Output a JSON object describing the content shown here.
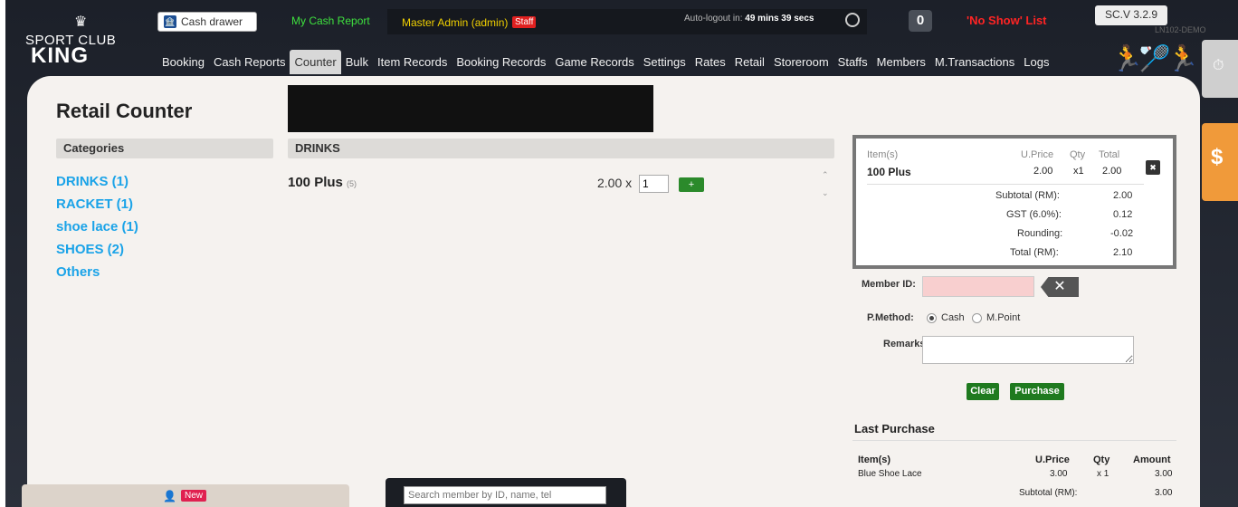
{
  "header": {
    "logo_line1": "SPORT CLUB",
    "logo_line2": "KING",
    "cash_drawer": "Cash drawer",
    "my_cash_report": "My Cash Report",
    "admin_name": "Master Admin (admin)",
    "staff_badge": "Staff",
    "auto_logout_label": "Auto-logout in:",
    "auto_logout_value": "49 mins 39 secs",
    "counter_value": "0",
    "no_show": "'No Show' List",
    "version": "SC.V 3.2.9",
    "site": "LN102-DEMO"
  },
  "nav": {
    "items": [
      "Booking",
      "Cash Reports",
      "Counter",
      "Bulk",
      "Item Records",
      "Booking Records",
      "Game Records",
      "Settings",
      "Rates",
      "Retail",
      "Storeroom",
      "Staffs",
      "Members",
      "M.Transactions",
      "Logs"
    ],
    "active": "Counter"
  },
  "page": {
    "title": "Retail Counter"
  },
  "categories": {
    "header": "Categories",
    "items": [
      "DRINKS (1)",
      "RACKET (1)",
      "shoe lace (1)",
      "SHOES (2)",
      "Others"
    ]
  },
  "products": {
    "header": "DRINKS",
    "items": [
      {
        "name": "100 Plus",
        "stock": "(5)",
        "price": "2.00 x",
        "qty": "1",
        "add": "+"
      }
    ]
  },
  "cart": {
    "headers": {
      "item": "Item(s)",
      "uprice": "U.Price",
      "qty": "Qty",
      "total": "Total"
    },
    "items": [
      {
        "name": "100 Plus",
        "uprice": "2.00",
        "qty": "x1",
        "total": "2.00"
      }
    ],
    "subtotal_label": "Subtotal (RM):",
    "subtotal": "2.00",
    "gst_label": "GST (6.0%):",
    "gst": "0.12",
    "rounding_label": "Rounding:",
    "rounding": "-0.02",
    "total_label": "Total (RM):",
    "total": "2.10"
  },
  "form": {
    "member_id_label": "Member ID:",
    "member_id_value": "",
    "pmethod_label": "P.Method:",
    "pmethod_options": [
      "Cash",
      "M.Point"
    ],
    "pmethod_selected": "Cash",
    "remarks_label": "Remarks:",
    "remarks_value": "",
    "clear_label": "Clear",
    "purchase_label": "Purchase"
  },
  "last_purchase": {
    "title": "Last Purchase",
    "headers": {
      "item": "Item(s)",
      "uprice": "U.Price",
      "qty": "Qty",
      "amount": "Amount"
    },
    "items": [
      {
        "name": "Blue Shoe Lace",
        "uprice": "3.00",
        "qty": "x 1",
        "amount": "3.00"
      }
    ],
    "subtotal_label": "Subtotal (RM):",
    "subtotal": "3.00"
  },
  "bottom": {
    "new_badge": "New",
    "search_placeholder": "Search member by ID, name, tel"
  }
}
